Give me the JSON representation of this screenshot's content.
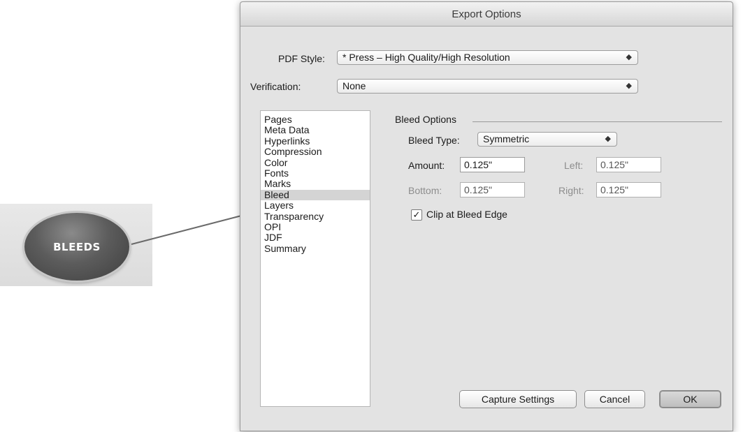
{
  "callout": {
    "label": "BLEEDS"
  },
  "dialog": {
    "title": "Export Options",
    "pdf_style": {
      "label": "PDF Style:",
      "value": "* Press – High Quality/High Resolution"
    },
    "verification": {
      "label": "Verification:",
      "value": "None"
    },
    "sidebar": {
      "items": [
        "Pages",
        "Meta Data",
        "Hyperlinks",
        "Compression",
        "Color",
        "Fonts",
        "Marks",
        "Bleed",
        "Layers",
        "Transparency",
        "OPI",
        "JDF",
        "Summary"
      ],
      "selected": "Bleed"
    },
    "bleed": {
      "section_title": "Bleed Options",
      "type_label": "Bleed Type:",
      "type_value": "Symmetric",
      "amount_label": "Amount:",
      "amount_value": "0.125\"",
      "left_label": "Left:",
      "left_value": "0.125\"",
      "bottom_label": "Bottom:",
      "bottom_value": "0.125\"",
      "right_label": "Right:",
      "right_value": "0.125\"",
      "clip_label": "Clip at Bleed Edge",
      "clip_checked": true
    },
    "buttons": {
      "capture": "Capture Settings",
      "cancel": "Cancel",
      "ok": "OK"
    }
  },
  "icons": {
    "popup_arrows": "⌃⌄",
    "check": "✓"
  }
}
